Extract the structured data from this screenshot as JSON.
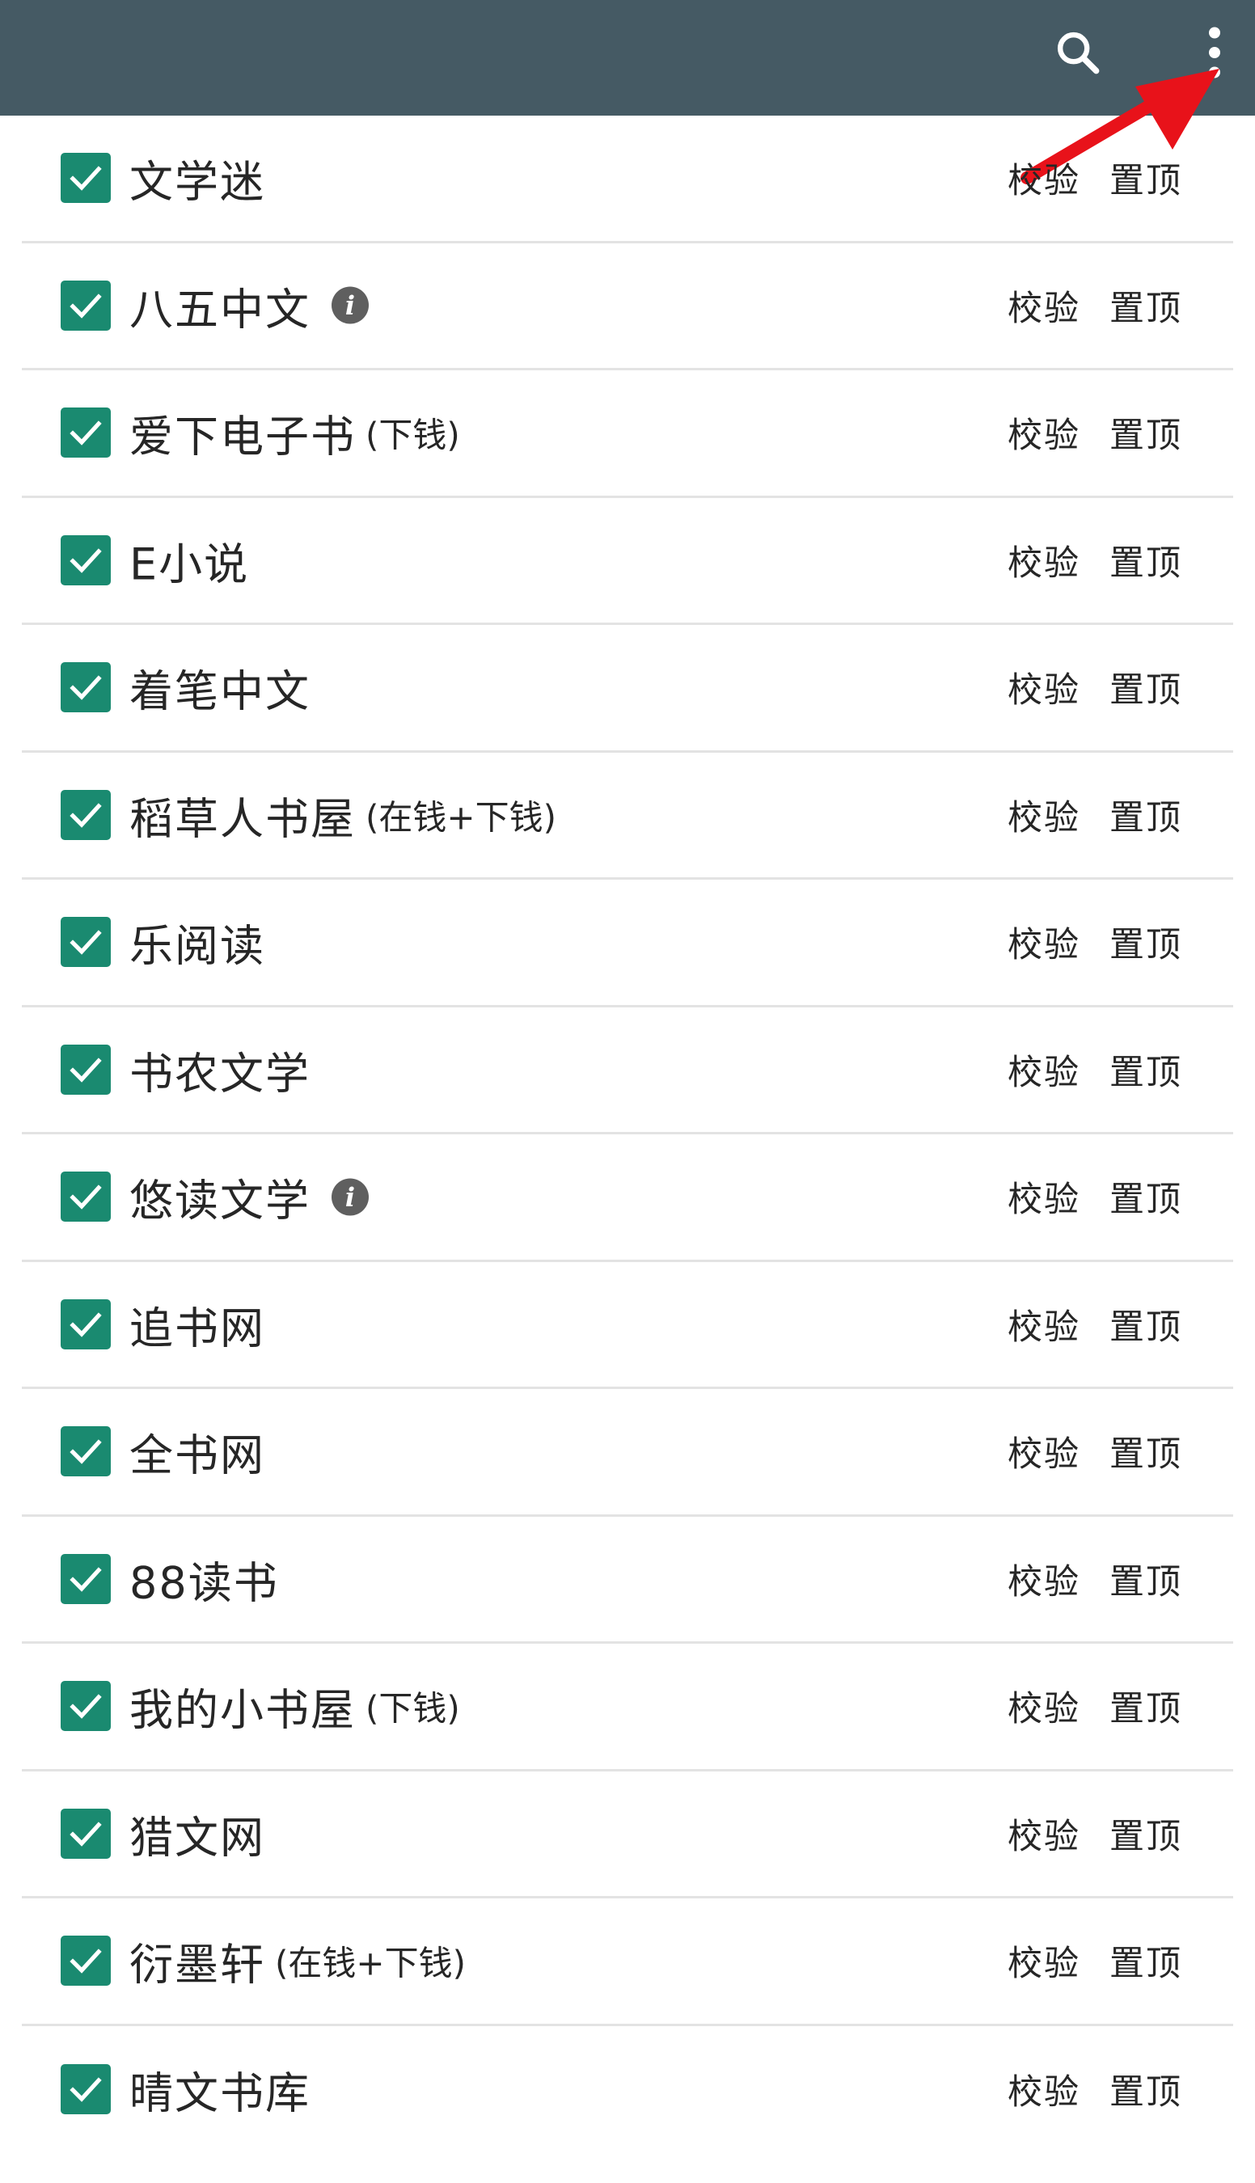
{
  "toolbar": {
    "search_icon": "search-icon",
    "more_icon": "more-vert-icon",
    "background": "#455a64"
  },
  "annotation": {
    "arrow_color": "#e8121a"
  },
  "colors": {
    "checkbox": "#1a8a70"
  },
  "sources": [
    {
      "name": "文学迷",
      "note": "",
      "info": false,
      "checked": true,
      "verify": "校验",
      "pin": "置顶"
    },
    {
      "name": "八五中文",
      "note": "",
      "info": true,
      "checked": true,
      "verify": "校验",
      "pin": "置顶"
    },
    {
      "name": "爱下电子书",
      "note": "(下钱)",
      "info": false,
      "checked": true,
      "verify": "校验",
      "pin": "置顶"
    },
    {
      "name": "E小说",
      "note": "",
      "info": false,
      "checked": true,
      "verify": "校验",
      "pin": "置顶"
    },
    {
      "name": "着笔中文",
      "note": "",
      "info": false,
      "checked": true,
      "verify": "校验",
      "pin": "置顶"
    },
    {
      "name": "稻草人书屋",
      "note": "(在钱+下钱)",
      "info": false,
      "checked": true,
      "verify": "校验",
      "pin": "置顶"
    },
    {
      "name": "乐阅读",
      "note": "",
      "info": false,
      "checked": true,
      "verify": "校验",
      "pin": "置顶"
    },
    {
      "name": "书农文学",
      "note": "",
      "info": false,
      "checked": true,
      "verify": "校验",
      "pin": "置顶"
    },
    {
      "name": "悠读文学",
      "note": "",
      "info": true,
      "checked": true,
      "verify": "校验",
      "pin": "置顶"
    },
    {
      "name": "追书网",
      "note": "",
      "info": false,
      "checked": true,
      "verify": "校验",
      "pin": "置顶"
    },
    {
      "name": "全书网",
      "note": "",
      "info": false,
      "checked": true,
      "verify": "校验",
      "pin": "置顶"
    },
    {
      "name": "88读书",
      "note": "",
      "info": false,
      "checked": true,
      "verify": "校验",
      "pin": "置顶"
    },
    {
      "name": "我的小书屋",
      "note": "(下钱)",
      "info": false,
      "checked": true,
      "verify": "校验",
      "pin": "置顶"
    },
    {
      "name": "猎文网",
      "note": "",
      "info": false,
      "checked": true,
      "verify": "校验",
      "pin": "置顶"
    },
    {
      "name": "衍墨轩",
      "note": "(在钱+下钱)",
      "info": false,
      "checked": true,
      "verify": "校验",
      "pin": "置顶"
    },
    {
      "name": "晴文书库",
      "note": "",
      "info": false,
      "checked": true,
      "verify": "校验",
      "pin": "置顶"
    }
  ]
}
